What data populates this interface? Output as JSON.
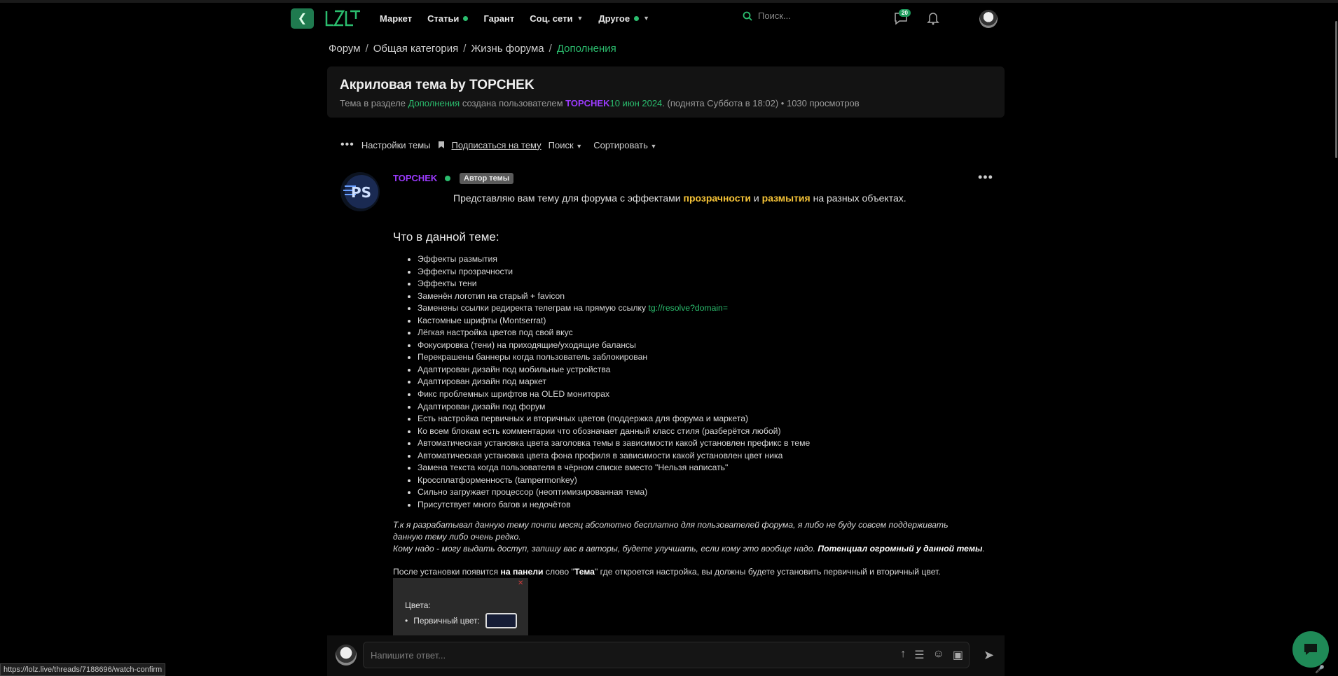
{
  "header": {
    "nav": [
      {
        "label": "Маркет",
        "dot": false,
        "chevron": false
      },
      {
        "label": "Статьи",
        "dot": true,
        "chevron": false
      },
      {
        "label": "Гарант",
        "dot": false,
        "chevron": false
      },
      {
        "label": "Соц. сети",
        "dot": false,
        "chevron": true
      },
      {
        "label": "Другое",
        "dot": true,
        "chevron": true
      }
    ],
    "search_placeholder": "Поиск...",
    "notifications_count": "20"
  },
  "breadcrumb": {
    "items": [
      "Форум",
      "Общая категория",
      "Жизнь форума"
    ],
    "current": "Дополнения",
    "separator": "/"
  },
  "thread": {
    "title": "Акриловая тема by TOPCHEK",
    "meta_prefix": "Тема в разделе",
    "meta_section": "Дополнения",
    "meta_created": "создана пользователем",
    "meta_author": "TOPCHEK",
    "meta_date": "10 июн 2024",
    "meta_bumped": ". (поднята Суббота в 18:02)",
    "meta_views": "• 1030 просмотров"
  },
  "controls": {
    "settings": "Настройки темы",
    "subscribe": "Подписаться на тему",
    "search": "Поиск",
    "sort": "Сортировать"
  },
  "post": {
    "author": "TOPCHEK",
    "badge": "Автор темы",
    "intro_1": "Представляю вам тему для форума с эффектами",
    "intro_hl1": "прозрачности",
    "intro_and": "и",
    "intro_hl2": "размытия",
    "intro_2": "на разных объектах.",
    "section_title": "Что в данной теме:",
    "features": [
      "Эффекты размытия",
      "Эффекты прозрачности",
      "Эффекты тени",
      "Заменён логотип на старый + favicon",
      "Заменены ссылки редиректа телеграм на прямую ссылку",
      "Кастомные шрифты (Montserrat)",
      "Лёгкая настройка цветов под свой вкус",
      "Фокусировка (тени) на приходящие/уходящие балансы",
      "Перекрашены баннеры когда пользователь заблокирован",
      "Адаптирован дизайн под мобильные устройства",
      "Адаптирован дизайн под маркет",
      "Фикс проблемных шрифтов на OLED мониторах",
      "Адаптирован дизайн под форум",
      "Есть настройка первичных и вторичных цветов (поддержка для форума и маркета)",
      "Ко всем блокам есть комментарии что обозначает данный класс стиля (разберётся любой)",
      "Автоматическая установка цвета заголовка темы в зависимости какой установлен префикс в теме",
      "Автоматическая установка цвета фона профиля в зависимости какой установлен цвет ника",
      "Замена текста когда пользователя в чёрном списке вместо \"Нельзя написать\"",
      "Кроссплатформенность (tampermonkey)",
      "Сильно загружает процессор (неоптимизированная тема)",
      "Присутствует много багов и недочётов"
    ],
    "feature_link": "tg://resolve?domain=",
    "para1_line1": "Т.к я разрабатывал данную тему почти месяц абсолютно бесплатно для пользователей форума, я либо не буду совсем поддерживать",
    "para1_line2": "данную тему либо очень редко.",
    "para2": "Кому надо - могу выдать доступ, запишу вас в авторы, будете улучшать, если кому это вообще надо.",
    "para2_bold": "Потенциал огромный у данной темы",
    "para3_a": "После установки появится",
    "para3_b": "на панели",
    "para3_c": "слово \"",
    "para3_d": "Тема",
    "para3_e": "\" где откроется настройка, вы должны будете установить первичный и вторичный цвет.",
    "preview_label": "Цвета:",
    "preview_primary": "Первичный цвет:"
  },
  "reply": {
    "placeholder": "Напишите ответ..."
  },
  "status_url": "https://lolz.live/threads/7188696/watch-confirm",
  "colors": {
    "accent": "#2bbd6e",
    "author": "#9c3bff",
    "highlight": "#f4c237"
  }
}
